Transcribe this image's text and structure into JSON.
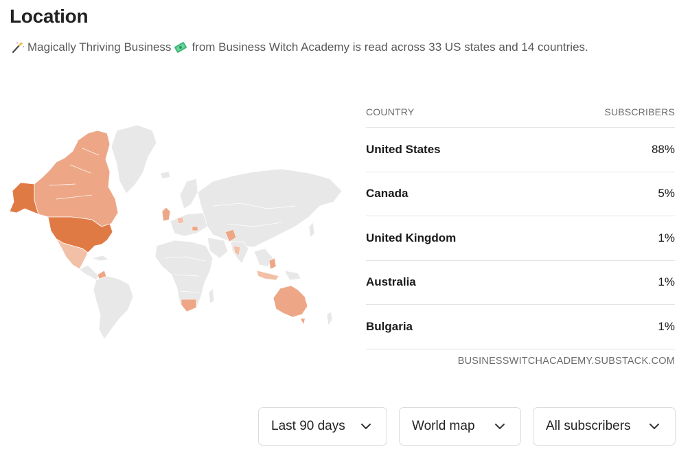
{
  "header": {
    "title": "Location",
    "summary_pre": "Magically Thriving Business",
    "summary_post": "from Business Witch Academy is read across 33 US states and 14 countries."
  },
  "table": {
    "col_country": "COUNTRY",
    "col_subscribers": "SUBSCRIBERS",
    "rows": [
      {
        "country": "United States",
        "pct": "88%"
      },
      {
        "country": "Canada",
        "pct": "5%"
      },
      {
        "country": "United Kingdom",
        "pct": "1%"
      },
      {
        "country": "Australia",
        "pct": "1%"
      },
      {
        "country": "Bulgaria",
        "pct": "1%"
      }
    ],
    "source": "BUSINESSWITCHACADEMY.SUBSTACK.COM"
  },
  "filters": {
    "range": "Last 90 days",
    "view": "World map",
    "audience": "All subscribers"
  },
  "colors": {
    "map_land": "#e8e8e8",
    "map_high": "#e07a45",
    "map_mid": "#eda787",
    "map_low": "#f2c0a6"
  },
  "icons": {
    "wand": "magic-wand-icon",
    "money": "money-icon",
    "chevron": "chevron-down-icon"
  }
}
